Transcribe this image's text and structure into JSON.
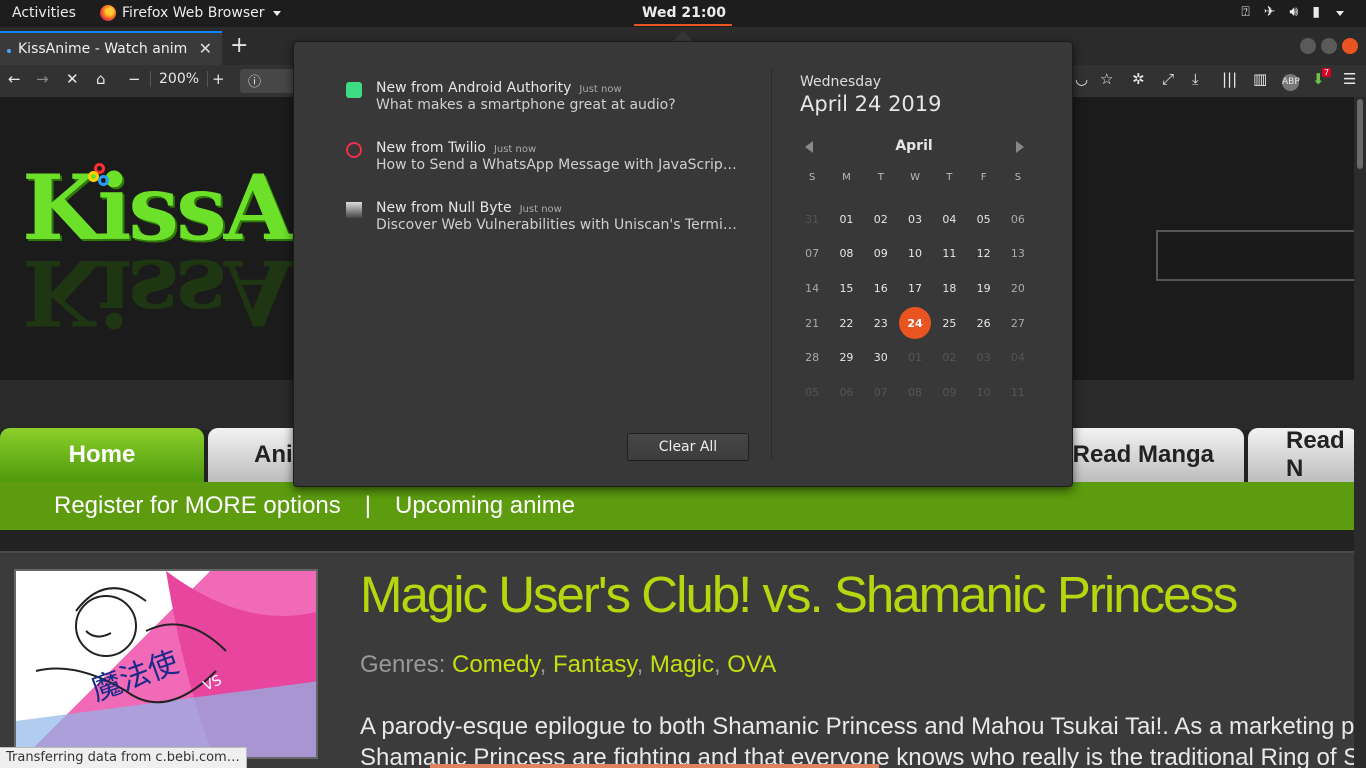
{
  "topbar": {
    "activities": "Activities",
    "app_menu": "Firefox Web Browser",
    "clock": "Wed 21:00",
    "tray_icons": [
      "network-question-icon",
      "airplane-icon",
      "volume-icon",
      "battery-icon",
      "system-menu-caret"
    ]
  },
  "browser": {
    "tab_title": "KissAnime - Watch anime",
    "zoom": "200%",
    "status_text": "Transferring data from c.bebi.com…",
    "download_badge": "7"
  },
  "notifications": [
    {
      "app": "New from Android Authority",
      "time": "Just now",
      "body": "What makes a smartphone great at audio?",
      "icon": "android-authority-icon"
    },
    {
      "app": "New from Twilio",
      "time": "Just now",
      "body": "How to Send a WhatsApp Message with JavaScript and Node.js",
      "icon": "twilio-icon"
    },
    {
      "app": "New from Null Byte",
      "time": "Just now",
      "body": "Discover Web Vulnerabilities with Uniscan's Terminal-Based Scanner",
      "icon": "null-byte-icon"
    }
  ],
  "clear_all": "Clear All",
  "calendar": {
    "weekday": "Wednesday",
    "date": "April 24 2019",
    "month": "April",
    "weekday_headers": [
      "S",
      "M",
      "T",
      "W",
      "T",
      "F",
      "S"
    ],
    "weeks": [
      [
        "31",
        "01",
        "02",
        "03",
        "04",
        "05",
        "06"
      ],
      [
        "07",
        "08",
        "09",
        "10",
        "11",
        "12",
        "13"
      ],
      [
        "14",
        "15",
        "16",
        "17",
        "18",
        "19",
        "20"
      ],
      [
        "21",
        "22",
        "23",
        "24",
        "25",
        "26",
        "27"
      ],
      [
        "28",
        "29",
        "30",
        "01",
        "02",
        "03",
        "04"
      ],
      [
        "05",
        "06",
        "07",
        "08",
        "09",
        "10",
        "11"
      ]
    ],
    "today": "24"
  },
  "site": {
    "logo_text": "KissAnime",
    "nav_tabs": [
      "Home",
      "Ani",
      "Read Manga",
      "Read N"
    ],
    "subnav": [
      "Register for MORE options",
      "|",
      "Upcoming anime"
    ],
    "title": "Magic User's Club! vs. Shamanic Princess",
    "genres_label": "Genres:",
    "genres": [
      "Comedy",
      "Fantasy",
      "Magic",
      "OVA"
    ],
    "summary_line1": "A parody-esque epilogue to both Shamanic Princess and Mahou Tsukai Tai!. As a marketing pl",
    "summary_line2": "Shamanic Princess are fighting and that everyone knows who really is the traditional Ring of S"
  },
  "colors": {
    "accent": "#e95420",
    "site_green": "#5c9c0e",
    "title_yellow_green": "#b7d60e",
    "firefox_blue": "#0a84ff"
  }
}
